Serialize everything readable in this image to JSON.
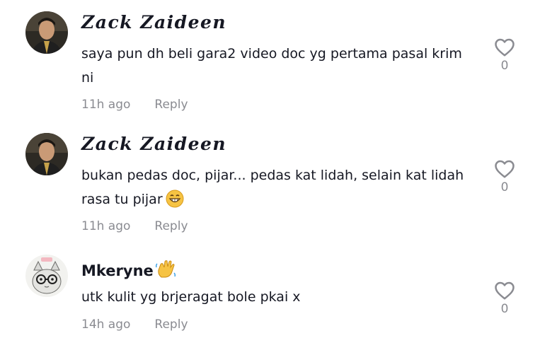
{
  "comments": [
    {
      "username": "Zack Zaideen",
      "text": "saya pun dh beli gara2 video doc yg pertama pasal krim ni",
      "time": "11h ago",
      "reply_label": "Reply",
      "likes": "0"
    },
    {
      "username": "Zack Zaideen",
      "text": "bukan pedas doc, pijar... pedas kat lidah, selain kat lidah rasa tu pijar",
      "time": "11h ago",
      "reply_label": "Reply",
      "likes": "0"
    },
    {
      "username": "Mkeryne",
      "text": "utk kulit yg brjeragat bole pkai x",
      "time": "14h ago",
      "reply_label": "Reply",
      "likes": "0"
    }
  ],
  "colors": {
    "text": "#161823",
    "muted": "#8a8b91",
    "heart": "#8a8b91"
  },
  "icons": {
    "like": "heart-outline-icon",
    "grin": "grinning-face-emoji",
    "wave": "waving-hand-emoji"
  }
}
